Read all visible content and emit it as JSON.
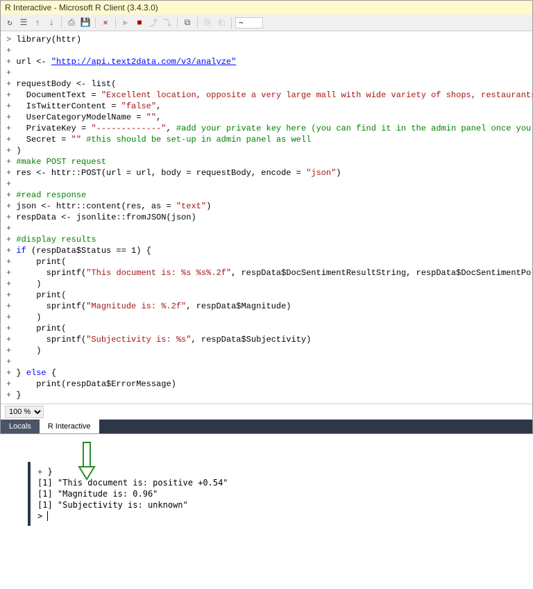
{
  "window": {
    "title": "R Interactive - Microsoft R Client (3.4.3.0)"
  },
  "toolbar": {
    "tilde": "~"
  },
  "code": {
    "prompt": ">",
    "cont": "+",
    "l1": "library(httr)",
    "l3a": "url <- ",
    "l3url": "\"http://api.text2data.com/v3/analyze\"",
    "l5": "requestBody <- list(",
    "l6a": "  DocumentText = ",
    "l6b": "\"Excellent location, opposite a very large mall with wide variety of shops, restaurants and more.\"",
    "l6c": ",",
    "l7a": "  IsTwitterContent = ",
    "l7b": "\"false\"",
    "l7c": ",",
    "l8a": "  UserCategoryModelName = ",
    "l8b": "\"\"",
    "l8c": ",",
    "l9a": "  PrivateKey = ",
    "l9b": "\"-------------\"",
    "l9c": ", ",
    "l9d": "#add your private key here (you can find it in the admin panel once you sign-up)",
    "l10a": "  Secret = ",
    "l10b": "\"\"",
    "l10c": " ",
    "l10d": "#this should be set-up in admin panel as well",
    "l11": ")",
    "l12": "#make POST request",
    "l13a": "res <- httr::POST(url = url, body = requestBody, encode = ",
    "l13b": "\"json\"",
    "l13c": ")",
    "l15": "#read response",
    "l16a": "json <- httr::content(res, as = ",
    "l16b": "\"text\"",
    "l16c": ")",
    "l17": "respData <- jsonlite::fromJSON(json)",
    "l19": "#display results",
    "l20a": "if",
    "l20b": " (respData$Status == 1) {",
    "l21": "    print(",
    "l22a": "      sprintf(",
    "l22b": "\"This document is: %s %s%.2f\"",
    "l22c": ", respData$DocSentimentResultString, respData$DocSentimentPolarity, respDat",
    "l23": "    )",
    "l24": "    print(",
    "l25a": "      sprintf(",
    "l25b": "\"Magnitude is: %.2f\"",
    "l25c": ", respData$Magnitude)",
    "l26": "    )",
    "l27": "    print(",
    "l28a": "      sprintf(",
    "l28b": "\"Subjectivity is: %s\"",
    "l28c": ", respData$Subjectivity)",
    "l29": "    )",
    "l31a": "} ",
    "l31b": "else",
    "l31c": " {",
    "l32": "    print(respData$ErrorMessage)",
    "l33": "}"
  },
  "status": {
    "zoom": "100 %"
  },
  "tabs": {
    "locals": "Locals",
    "rinteractive": "R Interactive"
  },
  "output": {
    "l1": "}",
    "l2": "[1] \"This document is: positive +0.54\"",
    "l3": "[1] \"Magnitude is: 0.96\"",
    "l4": "[1] \"Subjectivity is: unknown\"",
    "l5": "> "
  }
}
